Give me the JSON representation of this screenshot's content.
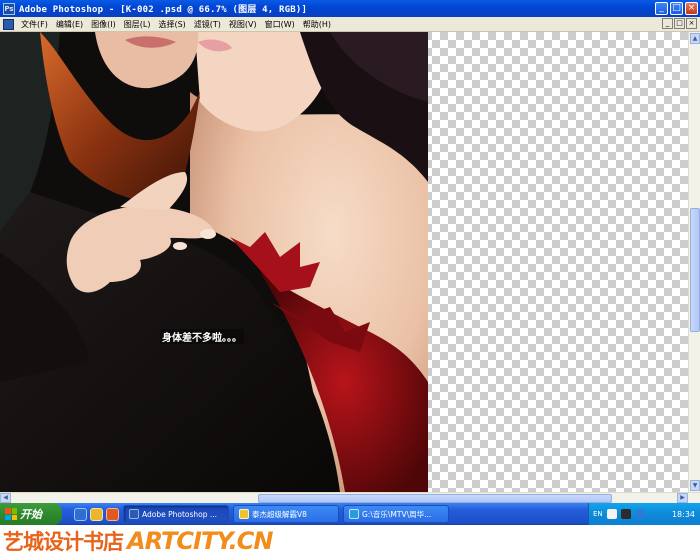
{
  "window": {
    "title": "Adobe Photoshop - [K-002 .psd @ 66.7% (图层 4, RGB)]",
    "buttons": [
      "_",
      "□",
      "×"
    ]
  },
  "menu": {
    "items": [
      "文件(F)",
      "编辑(E)",
      "图像(I)",
      "图层(L)",
      "选择(S)",
      "滤镜(T)",
      "视图(V)",
      "窗口(W)",
      "帮助(H)"
    ],
    "doc_buttons": [
      "_",
      "□",
      "×"
    ]
  },
  "canvas": {
    "caption": "身体差不多啦。。。",
    "colors": {
      "checker": "#cccccc",
      "skin": "#f1d2bd",
      "dark": "#140c0c",
      "red": "#8a0d0d",
      "copper": "#b4501e"
    }
  },
  "taskbar": {
    "start_label": "开始",
    "tasks": [
      {
        "label": "Adobe Photoshop ...",
        "icon": "photoshop-icon",
        "active": true
      },
      {
        "label": "泰杰超级解霸V8",
        "icon": "media-player-icon",
        "active": false
      },
      {
        "label": "G:\\音乐\\MTV\\周华...",
        "icon": "folder-icon",
        "active": false
      }
    ],
    "tray": {
      "lang": "EN",
      "time": "18:34"
    }
  },
  "watermark": {
    "cn": "艺城设计书店",
    "en": "ARTCITY.CN"
  }
}
